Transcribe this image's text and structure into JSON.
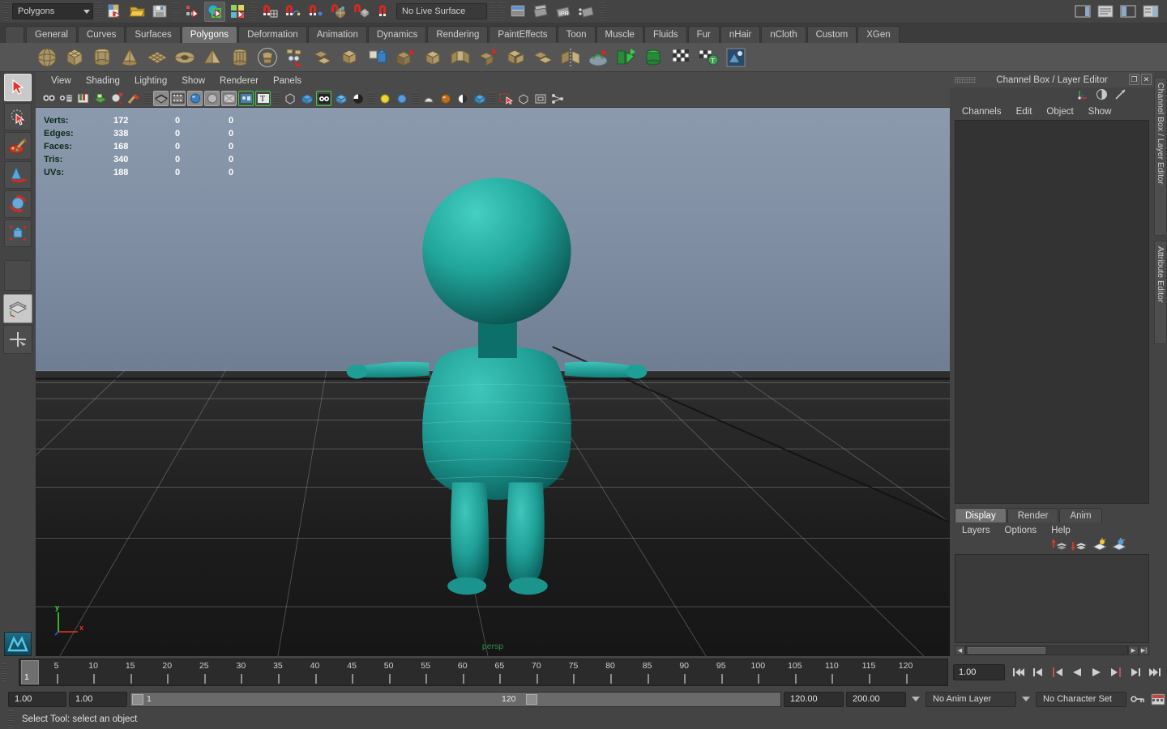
{
  "status_line": {
    "menu_set": "Polygons",
    "live_surface": "No Live Surface",
    "icons_left": [
      "new-scene-icon",
      "open-scene-icon",
      "save-scene-icon"
    ],
    "selection_icons": [
      "select-by-hierarchy-icon",
      "select-by-object-type-icon",
      "select-by-component-type-icon"
    ],
    "snap_icons": [
      "snap-to-grid-icon",
      "snap-to-curve-icon",
      "snap-to-point-icon",
      "snap-to-projected-center-icon",
      "snap-to-view-plane-icon"
    ],
    "render_icons": [
      "open-render-view-icon",
      "render-current-frame-icon",
      "ipr-render-icon",
      "render-settings-icon"
    ],
    "right_icons": [
      "sidebar-toggle-icon",
      "attribute-editor-icon",
      "tool-settings-icon",
      "channel-box-icon"
    ]
  },
  "shelf": {
    "tabs": [
      "General",
      "Curves",
      "Surfaces",
      "Polygons",
      "Deformation",
      "Animation",
      "Dynamics",
      "Rendering",
      "PaintEffects",
      "Toon",
      "Muscle",
      "Fluids",
      "Fur",
      "nHair",
      "nCloth",
      "Custom",
      "XGen"
    ],
    "selected_tab": "Polygons",
    "items": [
      "poly-sphere-icon",
      "poly-cube-icon",
      "poly-cylinder-icon",
      "poly-cone-icon",
      "poly-plane-icon",
      "poly-torus-icon",
      "poly-pyramid-icon",
      "poly-prism-icon",
      "poly-soccerball-icon",
      "poly-type-icon",
      "poly-combine-icon",
      "poly-booleans-icon",
      "poly-smooth-icon",
      "poly-extrude-icon",
      "poly-bevel-icon",
      "poly-bridge-icon",
      "poly-append-icon",
      "poly-wedge-icon",
      "poly-duplicate-face-icon",
      "poly-mirror-icon",
      "poly-sculpt-icon",
      "uv-planar-icon",
      "uv-cylindrical-icon",
      "uv-automatic-icon",
      "uv-editor-icon",
      "uv-texture-icon"
    ]
  },
  "toolbox": {
    "tools": [
      {
        "name": "select-tool",
        "selected": true
      },
      {
        "name": "lasso-select-tool",
        "selected": false
      },
      {
        "name": "paint-select-tool",
        "selected": false
      },
      {
        "name": "move-tool",
        "selected": false
      },
      {
        "name": "rotate-tool",
        "selected": false
      },
      {
        "name": "scale-tool",
        "selected": false
      }
    ],
    "layouts": [
      "single-perspective-layout",
      "four-view-layout",
      "outliner-persp-layout"
    ]
  },
  "viewport": {
    "menus": [
      "View",
      "Shading",
      "Lighting",
      "Show",
      "Renderer",
      "Panels"
    ],
    "toolbar_icons": [
      "select-camera-icon",
      "camera-attributes-icon",
      "bookmark-icon",
      "image-plane-icon",
      "two-d-pan-zoom-icon",
      "paint-brush-icon",
      "wireframe-icon",
      "smooth-shade-all-icon",
      "smooth-shade-textured-icon",
      "use-all-lights-icon",
      "shadows-icon",
      "xray-icon",
      "texture-icon",
      "grid-icon",
      "film-gate-icon",
      "resolution-gate-icon",
      "gate-mask-icon",
      "light-icon",
      "light-two-icon",
      "exposure-icon",
      "gamma-icon",
      "isolate-select-icon",
      "bounding-box-icon",
      "render-region-icon",
      "panel-layout-icon"
    ],
    "camera_label": "persp",
    "axis": {
      "y_label": "y",
      "x_label": "x",
      "y_color": "#33dd33",
      "x_color": "#ee3322",
      "z_color": "#3355ee"
    },
    "hud": {
      "rows": [
        {
          "label": "Verts:",
          "value": "172",
          "col2": "0",
          "col3": "0"
        },
        {
          "label": "Edges:",
          "value": "338",
          "col2": "0",
          "col3": "0"
        },
        {
          "label": "Faces:",
          "value": "168",
          "col2": "0",
          "col3": "0"
        },
        {
          "label": "Tris:",
          "value": "340",
          "col2": "0",
          "col3": "0"
        },
        {
          "label": "UVs:",
          "value": "188",
          "col2": "0",
          "col3": "0"
        }
      ]
    },
    "model": {
      "name": "character-mesh",
      "color": "#1f9e96",
      "shadow_color": "#0c5a56"
    }
  },
  "channel_box": {
    "title": "Channel Box / Layer Editor",
    "restore_label": "❐",
    "close_label": "✕",
    "menus": [
      "Channels",
      "Edit",
      "Object",
      "Show"
    ],
    "header_icons": [
      "channel-box-icon",
      "attribute-editor-icon",
      "modeling-toolkit-icon"
    ]
  },
  "layer_editor": {
    "tabs": [
      "Display",
      "Render",
      "Anim"
    ],
    "selected_tab": "Display",
    "menus": [
      "Layers",
      "Options",
      "Help"
    ],
    "icons": [
      "new-layer-from-selected-icon",
      "new-empty-layer-icon",
      "layer-light-icon",
      "layer-light-selected-icon"
    ]
  },
  "side_tabs": [
    "Channel Box / Layer Editor",
    "Attribute Editor"
  ],
  "timeline": {
    "ticks": [
      5,
      10,
      15,
      20,
      25,
      30,
      35,
      40,
      45,
      50,
      55,
      60,
      65,
      70,
      75,
      80,
      85,
      90,
      95,
      100,
      105,
      110,
      115,
      120
    ],
    "start": 1,
    "end": 120,
    "current_frame_marker": "1",
    "current_frame_field": "1.00",
    "playback_buttons": [
      "go-to-start-icon",
      "step-back-keyframe-icon",
      "step-back-frame-icon",
      "play-backwards-icon",
      "play-forwards-icon",
      "step-forward-frame-icon",
      "step-forward-keyframe-icon",
      "go-to-end-icon"
    ]
  },
  "range_slider": {
    "anim_start": "1.00",
    "range_start": "1.00",
    "slider_start_label": "1",
    "slider_end_label": "120",
    "range_end": "120.00",
    "anim_end": "200.00",
    "anim_layer": "No Anim Layer",
    "character_set": "No Character Set",
    "right_icons": [
      "auto-keyframe-icon",
      "animation-preferences-icon"
    ]
  },
  "help_line": {
    "message": "Select Tool: select an object"
  }
}
